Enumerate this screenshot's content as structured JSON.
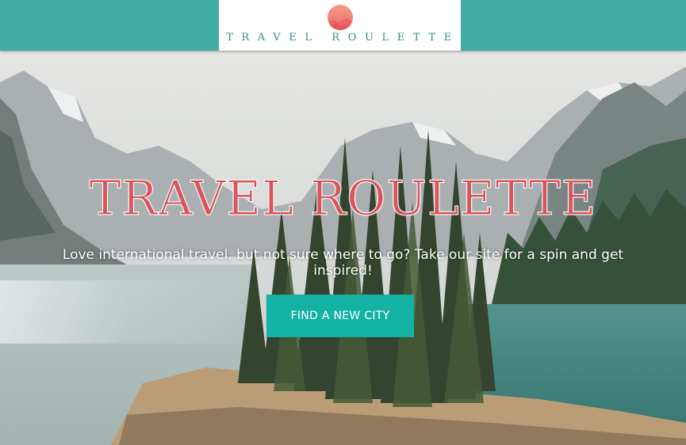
{
  "header": {
    "logo_text": "TRAVEL ROULETTE",
    "logo_icon": "sunset-mountain-logo-icon",
    "background_color": "#40aca4"
  },
  "hero": {
    "background_image": "mountain-lake-forest-photo",
    "title": "TRAVEL ROULETTE",
    "title_color": "#d8555c",
    "subtitle": "Love international travel, but not sure where to go? Take our site for a spin and get inspired!",
    "cta_label": "FIND A NEW CITY",
    "cta_color": "#14b2a5"
  }
}
